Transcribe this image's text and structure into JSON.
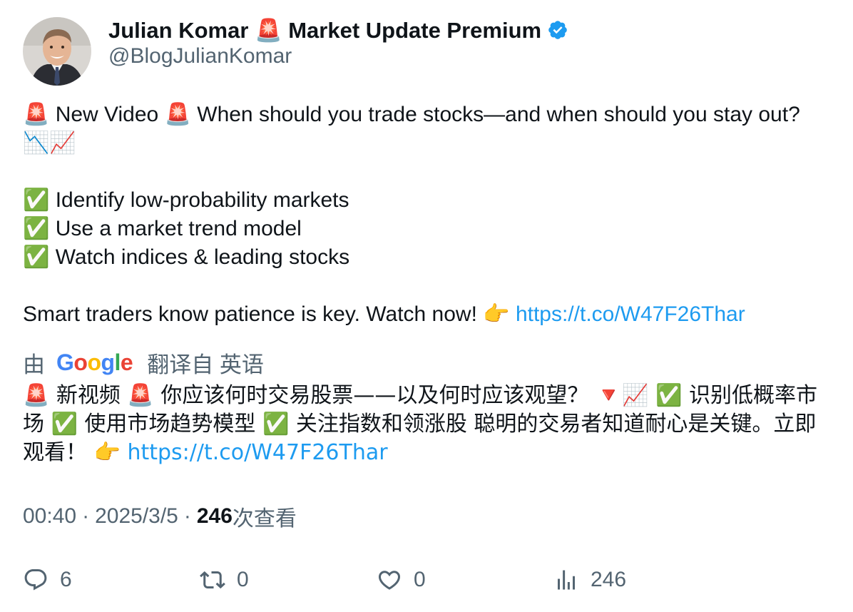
{
  "author": {
    "display_name": "Julian Komar 🚨 Market Update Premium",
    "handle": "@BlogJulianKomar",
    "verified_icon": "verified-badge-icon"
  },
  "tweet": {
    "line1": "🚨 New Video 🚨 When should you trade stocks—and when should you stay out? 📉📈",
    "bullet1": "✅ Identify low-probability markets",
    "bullet2": "✅ Use a market trend model",
    "bullet3": "✅ Watch indices & leading stocks",
    "closing": "Smart traders know patience is key. Watch now!  👉 ",
    "link": "https://t.co/W47F26Thar"
  },
  "translation": {
    "by_label": "由",
    "google_letters": [
      "G",
      "o",
      "o",
      "g",
      "l",
      "e"
    ],
    "from_label": "翻译自 英语",
    "text": "🚨 新视频 🚨 你应该何时交易股票——以及何时应该观望？ 🔻📈 ✅ 识别低概率市场 ✅ 使用市场趋势模型 ✅ 关注指数和领涨股 聪明的交易者知道耐心是关键。立即观看！ 👉 ",
    "link": "https://t.co/W47F26Thar"
  },
  "meta": {
    "time": "00:40",
    "separator": "·",
    "date": "2025/3/5",
    "views_count": "246",
    "views_label": "次查看"
  },
  "actions": {
    "reply_count": "6",
    "retweet_count": "0",
    "like_count": "0",
    "views_count": "246"
  },
  "colors": {
    "link": "#1d9bf0",
    "muted": "#536471",
    "text": "#0f1419",
    "verified": "#1d9bf0"
  }
}
